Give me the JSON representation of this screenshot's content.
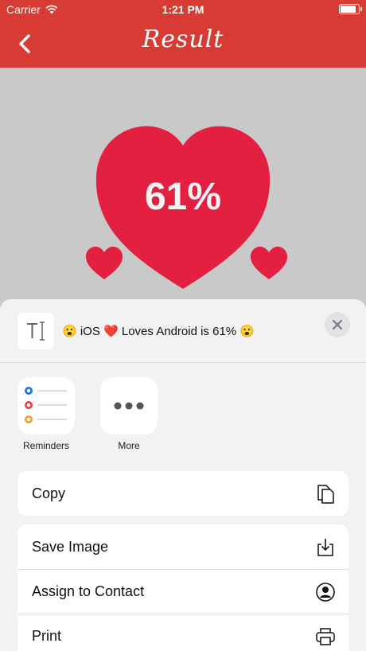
{
  "status_bar": {
    "carrier": "Carrier",
    "time": "1:21 PM",
    "battery_level": 0.9
  },
  "nav": {
    "back_icon": "chevron-left-icon",
    "title": "Result"
  },
  "result": {
    "percentage": "61%",
    "accent_color": "#e42040",
    "background_color": "#c9c9c9"
  },
  "share": {
    "thumb_icon": "text-cursor-icon",
    "message": "😮 iOS ❤️ Loves Android is 61% 😮",
    "close_icon": "close-icon",
    "apps": [
      {
        "label": "Reminders",
        "icon": "reminders-icon"
      },
      {
        "label": "More",
        "icon": "more-icon"
      }
    ],
    "actions": [
      {
        "label": "Copy",
        "icon": "copy-icon"
      },
      {
        "label": "Save Image",
        "icon": "save-icon"
      },
      {
        "label": "Assign to Contact",
        "icon": "contact-icon"
      },
      {
        "label": "Print",
        "icon": "print-icon"
      }
    ]
  },
  "colors": {
    "header": "#d83b33",
    "sheet": "#f2f2f4"
  }
}
